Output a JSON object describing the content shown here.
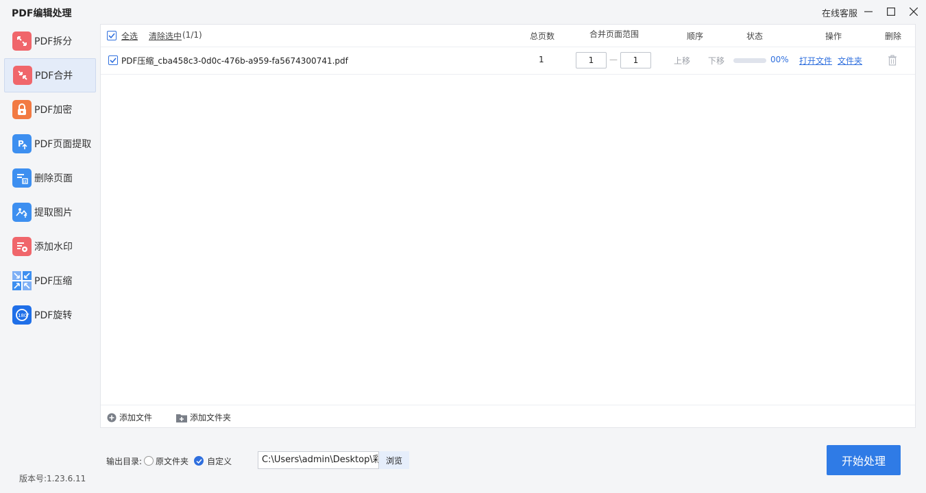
{
  "app": {
    "title": "PDF编辑处理",
    "online_service": "在线客服",
    "version": "版本号:1.23.6.11"
  },
  "sidebar": {
    "items": [
      {
        "label": "PDF拆分",
        "icon": "split-icon",
        "color": "#f0666b"
      },
      {
        "label": "PDF合并",
        "icon": "merge-icon",
        "color": "#f0666b",
        "active": true
      },
      {
        "label": "PDF加密",
        "icon": "lock-icon",
        "color": "#f27a43"
      },
      {
        "label": "PDF页面提取",
        "icon": "page-extract-icon",
        "color": "#3d8ff0"
      },
      {
        "label": "删除页面",
        "icon": "delete-page-icon",
        "color": "#3d8ff0"
      },
      {
        "label": "提取图片",
        "icon": "image-extract-icon",
        "color": "#3d8ff0"
      },
      {
        "label": "添加水印",
        "icon": "watermark-icon",
        "color": "#f0666b"
      },
      {
        "label": "PDF压缩",
        "icon": "compress-icon",
        "color": "#3d8ff0"
      },
      {
        "label": "PDF旋转",
        "icon": "rotate-icon",
        "color": "#1f6fe8"
      }
    ]
  },
  "table": {
    "select_all": "全选",
    "clear_selected": "清除选中",
    "selected_count": "(1/1)",
    "headers": {
      "total_pages": "总页数",
      "merge_range": "合并页面范围",
      "order": "顺序",
      "status": "状态",
      "actions": "操作",
      "delete": "删除"
    },
    "rows": [
      {
        "filename": "PDF压缩_cba458c3-0d0c-476b-a959-fa5674300741.pdf",
        "total_pages": "1",
        "range_from": "1",
        "range_to": "1",
        "range_sep": "—",
        "move_up": "上移",
        "move_down": "下移",
        "progress": 0,
        "status_text": "00%",
        "open_file": "打开文件",
        "open_folder": "文件夹"
      }
    ]
  },
  "footer": {
    "add_file": "添加文件",
    "add_folder": "添加文件夹"
  },
  "output": {
    "label": "输出目录:",
    "option_original": "原文件夹",
    "option_custom": "自定义",
    "selected": "custom",
    "path": "C:\\Users\\admin\\Desktop\\彩虹办公",
    "browse": "浏览"
  },
  "start_button": "开始处理",
  "colors": {
    "accent": "#2f6fde",
    "start_button": "#2f7be6",
    "active_sidebar": "#e4ecf9"
  }
}
